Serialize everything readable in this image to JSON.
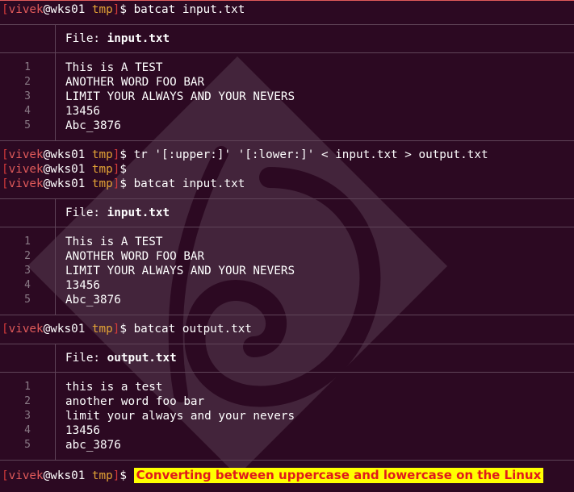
{
  "prompt": {
    "open": "[",
    "user": "vivek",
    "at": "@",
    "host": "wks01",
    "dir": "tmp",
    "close": "]",
    "dollar": "$"
  },
  "commands": {
    "c1": "batcat input.txt",
    "c2": "tr '[:upper:]' '[:lower:]' < input.txt > output.txt",
    "c3": "",
    "c4": "batcat input.txt",
    "c5": "batcat output.txt"
  },
  "file_label": "File: ",
  "files": {
    "f1": {
      "name": "input.txt",
      "lines": [
        "This is A TEST",
        "ANOTHER WORD FOO BAR",
        "LIMIT YOUR ALWAYS AND YOUR NEVERS",
        "13456",
        "Abc_3876"
      ]
    },
    "f2": {
      "name": "input.txt",
      "lines": [
        "This is A TEST",
        "ANOTHER WORD FOO BAR",
        "LIMIT YOUR ALWAYS AND YOUR NEVERS",
        "13456",
        "Abc_3876"
      ]
    },
    "f3": {
      "name": "output.txt",
      "lines": [
        "this is a test",
        "another word foo bar",
        "limit your always and your nevers",
        "13456",
        "abc_3876"
      ]
    }
  },
  "line_numbers": [
    "1",
    "2",
    "3",
    "4",
    "5"
  ],
  "caption": "Converting between uppercase and lowercase on the Linux",
  "colors": {
    "background": "#2c0922",
    "user": "#e05a5a",
    "dir": "#e2a235",
    "caption_bg": "#ffff00",
    "caption_fg": "#e01b1b"
  }
}
